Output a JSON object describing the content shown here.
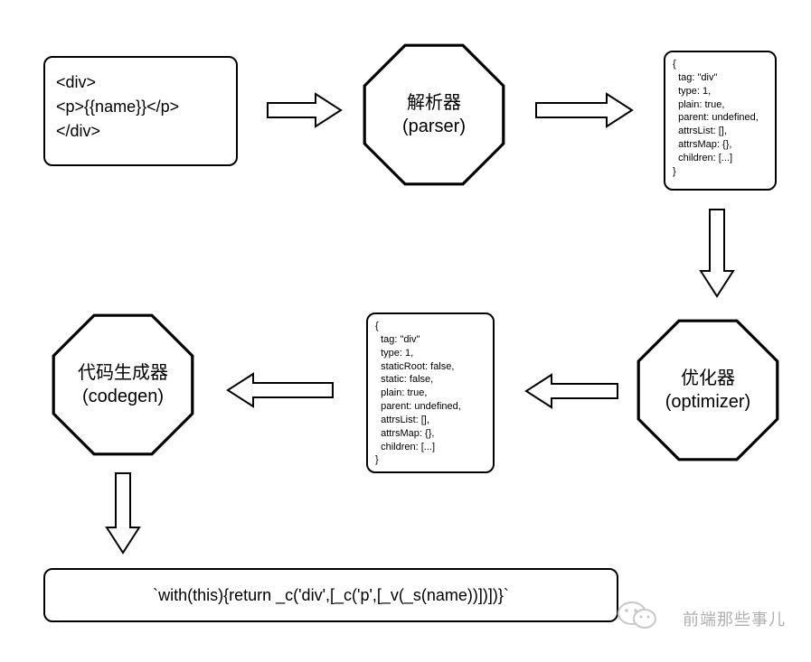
{
  "template": {
    "line1": "<div>",
    "line2": "",
    "line3": "<p>{{name}}</p>",
    "line4": "</div>"
  },
  "parser": {
    "title": "解析器",
    "subtitle": "(parser)"
  },
  "ast1": "{\n  tag: \"div\"\n  type: 1,\n  plain: true,\n  parent: undefined,\n  attrsList: [],\n  attrsMap: {},\n  children: [...]\n}",
  "optimizer": {
    "title": "优化器",
    "subtitle": "(optimizer)"
  },
  "ast2": "{\n  tag: \"div\"\n  type: 1,\n  staticRoot: false,\n  static: false,\n  plain: true,\n  parent: undefined,\n  attrsList: [],\n  attrsMap: {},\n  children: [...]\n}",
  "codegen": {
    "title": "代码生成器",
    "subtitle": "(codegen)"
  },
  "output": "`with(this){return _c('div',[_c('p',[_v(_s(name))])])}`",
  "watermark": "前端那些事儿"
}
